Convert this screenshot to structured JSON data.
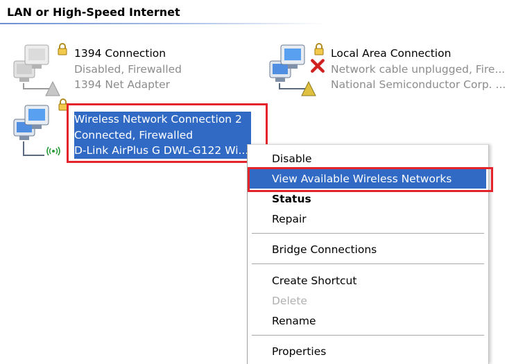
{
  "group": {
    "title": "LAN or High-Speed Internet"
  },
  "connections": [
    {
      "name": "1394 Connection",
      "status": "Disabled, Firewalled",
      "device": "1394 Net Adapter"
    },
    {
      "name": "Local Area Connection",
      "status": "Network cable unplugged, Fire...",
      "device": "National Semiconductor Corp. ..."
    },
    {
      "name": "Wireless Network Connection 2",
      "status": "Connected, Firewalled",
      "device": "D-Link AirPlus G DWL-G122 Wi..."
    }
  ],
  "context_menu": {
    "items": [
      {
        "label": "Disable"
      },
      {
        "label": "View Available Wireless Networks"
      },
      {
        "label": "Status"
      },
      {
        "label": "Repair"
      },
      {
        "label": "Bridge Connections"
      },
      {
        "label": "Create Shortcut"
      },
      {
        "label": "Delete"
      },
      {
        "label": "Rename"
      },
      {
        "label": "Properties"
      }
    ]
  },
  "colors": {
    "selection": "#316ac5",
    "annotation_border": "#e5232a",
    "secondary_text": "#8c8c8c"
  },
  "icons": [
    "network-computers-icon",
    "lock-icon",
    "wireless-signal-icon",
    "disconnected-x-icon",
    "network-connector-icon"
  ]
}
